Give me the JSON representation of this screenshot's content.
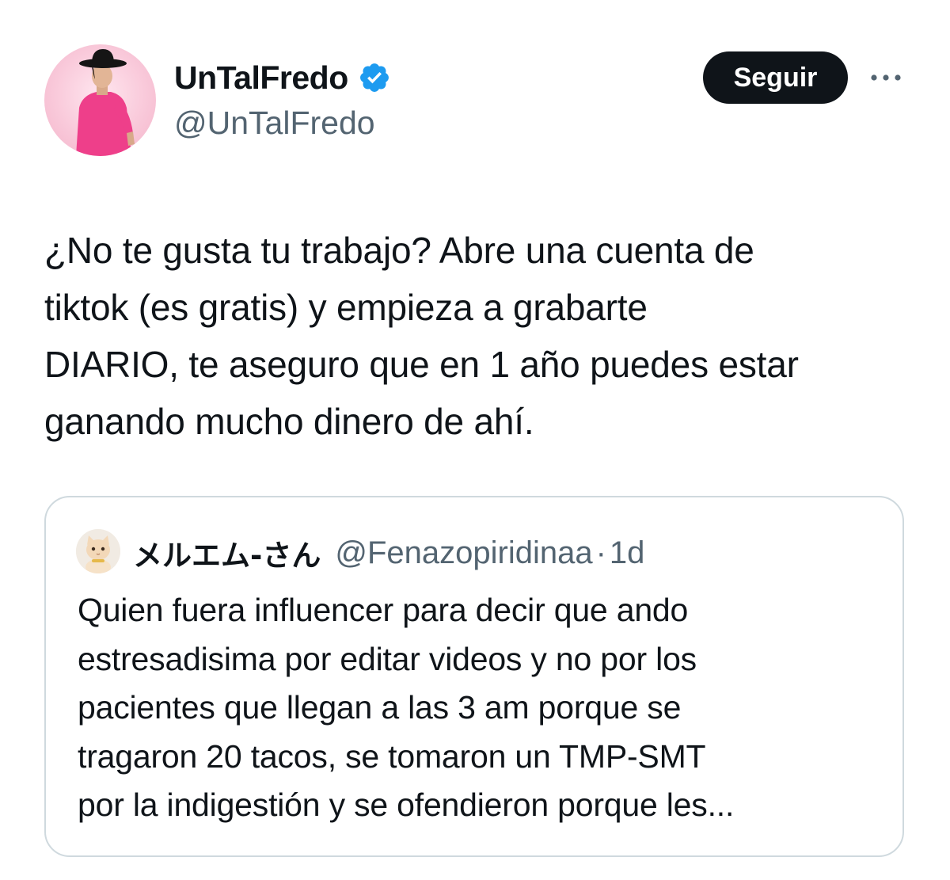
{
  "tweet": {
    "author": {
      "display_name": "UnTalFredo",
      "handle": "@UnTalFredo",
      "verified_icon": "verified-badge-icon",
      "avatar_icon": "profile-photo"
    },
    "follow_label": "Seguir",
    "more_icon": "more-options-icon",
    "text": "¿No te gusta tu trabajo? Abre una cuenta de\ntiktok (es gratis) y empieza a grabarte\nDIARIO, te aseguro que en 1 año puedes estar\nganando mucho dinero de ahí."
  },
  "quote": {
    "author": {
      "display_name": "メルエム-さん",
      "handle": "@Fenazopiridinaa",
      "avatar_icon": "cat-photo"
    },
    "separator": "·",
    "time": "1d",
    "text": "Quien fuera influencer para decir que ando\nestresadisima por editar videos y no por los\npacientes que llegan a las 3 am porque se\ntragaron 20 tacos, se tomaron un TMP-SMT\npor la indigestión y se ofendieron porque les..."
  },
  "colors": {
    "text_primary": "#0f1419",
    "text_secondary": "#536471",
    "verified_blue": "#1d9bf0",
    "button_bg": "#0f1419",
    "button_text": "#ffffff",
    "card_border": "#cfd9de"
  }
}
